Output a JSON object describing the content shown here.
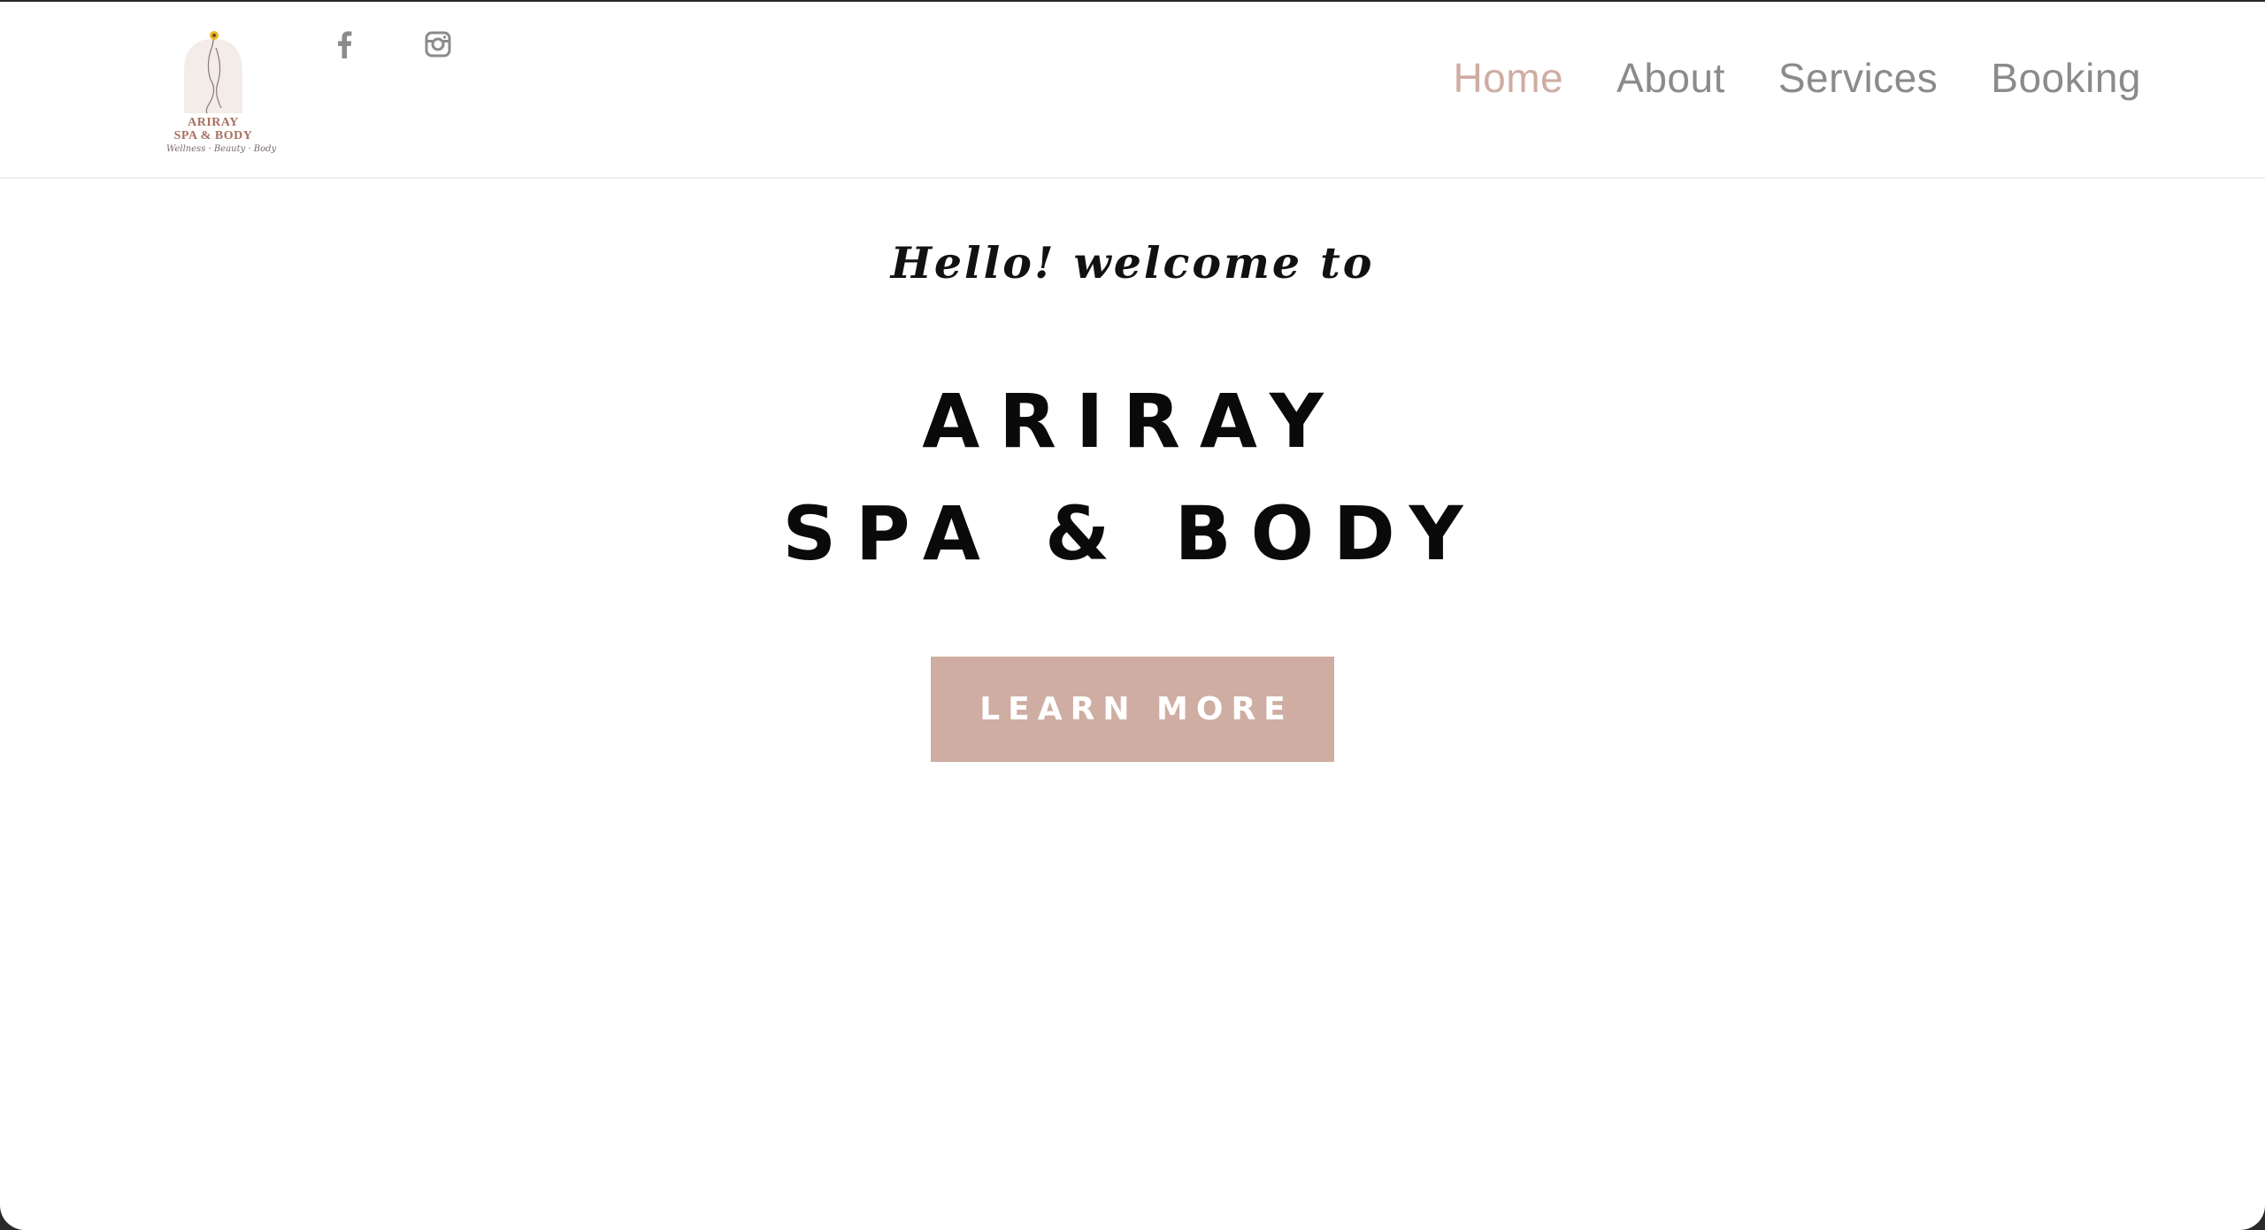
{
  "header": {
    "logo": {
      "name_line1": "ARIRAY",
      "name_line2": "SPA & BODY",
      "tagline": "Wellness · Beauty · Body"
    },
    "social": [
      {
        "icon": "facebook-icon"
      },
      {
        "icon": "instagram-icon"
      }
    ],
    "nav": {
      "items": [
        {
          "label": "Home",
          "active": true
        },
        {
          "label": "About",
          "active": false
        },
        {
          "label": "Services",
          "active": false
        },
        {
          "label": "Booking",
          "active": false
        }
      ]
    }
  },
  "hero": {
    "greeting": "Hello! welcome to",
    "title_line1": "ARIRAY",
    "title_line2": "SPA & BODY",
    "cta_label": "LEARN MORE"
  },
  "colors": {
    "accent": "#cfada2",
    "nav_active": "#cfaca3",
    "nav_default": "#8b8b8b",
    "logo_text": "#a86f5f",
    "flower": "#e8b923"
  }
}
